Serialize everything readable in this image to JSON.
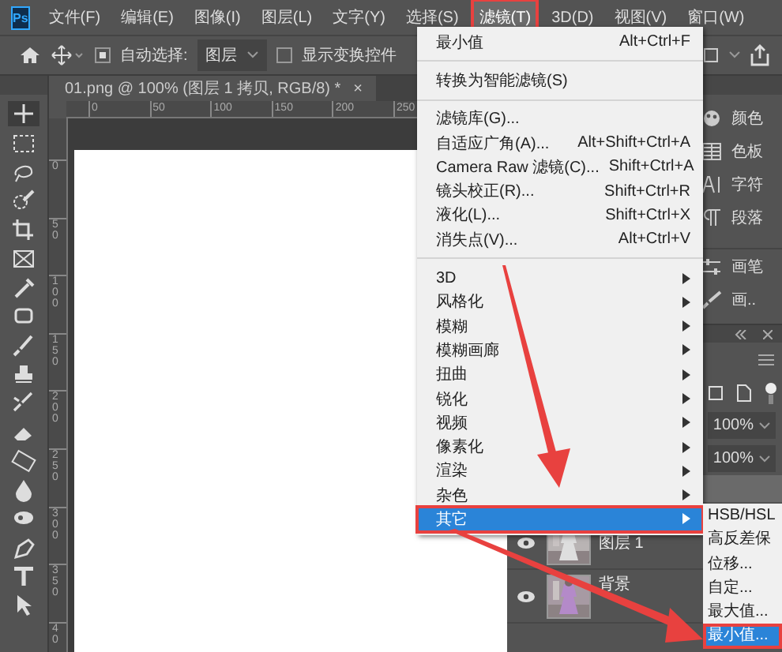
{
  "app_icon": "Ps",
  "menu_bar": [
    {
      "label": "文件(F)",
      "selected": false,
      "annotated": false
    },
    {
      "label": "编辑(E)",
      "selected": false,
      "annotated": false
    },
    {
      "label": "图像(I)",
      "selected": false,
      "annotated": false
    },
    {
      "label": "图层(L)",
      "selected": false,
      "annotated": false
    },
    {
      "label": "文字(Y)",
      "selected": false,
      "annotated": false
    },
    {
      "label": "选择(S)",
      "selected": false,
      "annotated": false
    },
    {
      "label": "滤镜(T)",
      "selected": true,
      "annotated": true
    },
    {
      "label": "3D(D)",
      "selected": false,
      "annotated": false
    },
    {
      "label": "视图(V)",
      "selected": false,
      "annotated": false
    },
    {
      "label": "窗口(W)",
      "selected": false,
      "annotated": false
    }
  ],
  "options_bar": {
    "auto_select": {
      "label": "自动选择:",
      "checked": true
    },
    "target": "图层",
    "show_transform": {
      "label": "显示变换控件",
      "checked": false
    }
  },
  "document_tab": {
    "title": "01.png @ 100% (图层 1 拷贝, RGB/8) *",
    "close": "×"
  },
  "rulers": {
    "horizontal": [
      "0",
      "50",
      "100",
      "150",
      "200",
      "250"
    ],
    "vertical": [
      "0",
      "50",
      "100",
      "150",
      "200",
      "250",
      "300",
      "350",
      "40"
    ]
  },
  "filter_menu": [
    {
      "kind": "item",
      "label": "最小值",
      "shortcut": "Alt+Ctrl+F",
      "selected": false,
      "annotated": false
    },
    {
      "kind": "separator"
    },
    {
      "kind": "item",
      "label": "转换为智能滤镜(S)",
      "selected": false,
      "annotated": false
    },
    {
      "kind": "separator"
    },
    {
      "kind": "item",
      "label": "滤镜库(G)...",
      "selected": false,
      "annotated": false
    },
    {
      "kind": "item",
      "label": "自适应广角(A)...",
      "shortcut": "Alt+Shift+Ctrl+A",
      "selected": false,
      "annotated": false
    },
    {
      "kind": "item",
      "label": "Camera Raw 滤镜(C)...",
      "shortcut": "Shift+Ctrl+A",
      "selected": false,
      "annotated": false
    },
    {
      "kind": "item",
      "label": "镜头校正(R)...",
      "shortcut": "Shift+Ctrl+R",
      "selected": false,
      "annotated": false
    },
    {
      "kind": "item",
      "label": "液化(L)...",
      "shortcut": "Shift+Ctrl+X",
      "selected": false,
      "annotated": false
    },
    {
      "kind": "item",
      "label": "消失点(V)...",
      "shortcut": "Alt+Ctrl+V",
      "selected": false,
      "annotated": false
    },
    {
      "kind": "separator"
    },
    {
      "kind": "submenu",
      "label": "3D",
      "selected": false,
      "annotated": false
    },
    {
      "kind": "submenu",
      "label": "风格化",
      "selected": false,
      "annotated": false
    },
    {
      "kind": "submenu",
      "label": "模糊",
      "selected": false,
      "annotated": false
    },
    {
      "kind": "submenu",
      "label": "模糊画廊",
      "selected": false,
      "annotated": false
    },
    {
      "kind": "submenu",
      "label": "扭曲",
      "selected": false,
      "annotated": false
    },
    {
      "kind": "submenu",
      "label": "锐化",
      "selected": false,
      "annotated": false
    },
    {
      "kind": "submenu",
      "label": "视频",
      "selected": false,
      "annotated": false
    },
    {
      "kind": "submenu",
      "label": "像素化",
      "selected": false,
      "annotated": false
    },
    {
      "kind": "submenu",
      "label": "渲染",
      "selected": false,
      "annotated": false
    },
    {
      "kind": "submenu",
      "label": "杂色",
      "selected": false,
      "annotated": false
    },
    {
      "kind": "submenu",
      "label": "其它",
      "selected": true,
      "annotated": true
    }
  ],
  "other_submenu": [
    {
      "label": "HSB/HSL",
      "selected": false,
      "annotated": false
    },
    {
      "label": "高反差保",
      "selected": false,
      "annotated": false
    },
    {
      "label": "位移...",
      "selected": false,
      "annotated": false
    },
    {
      "label": "自定...",
      "selected": false,
      "annotated": false
    },
    {
      "label": "最大值...",
      "selected": false,
      "annotated": false
    },
    {
      "label": "最小值...",
      "selected": true,
      "annotated": true
    }
  ],
  "panel_dock": [
    {
      "label": "颜色"
    },
    {
      "label": "色板"
    },
    {
      "label": "字符"
    },
    {
      "label": "段落"
    },
    {
      "label": "画笔"
    },
    {
      "label": "画.."
    }
  ],
  "layers_panel": {
    "opacity": "100%",
    "fill": "100%",
    "layers": [
      {
        "name": "图层 1",
        "visible": true,
        "kind": "picture"
      },
      {
        "name": "背景",
        "visible": true,
        "kind": "picture"
      }
    ]
  }
}
